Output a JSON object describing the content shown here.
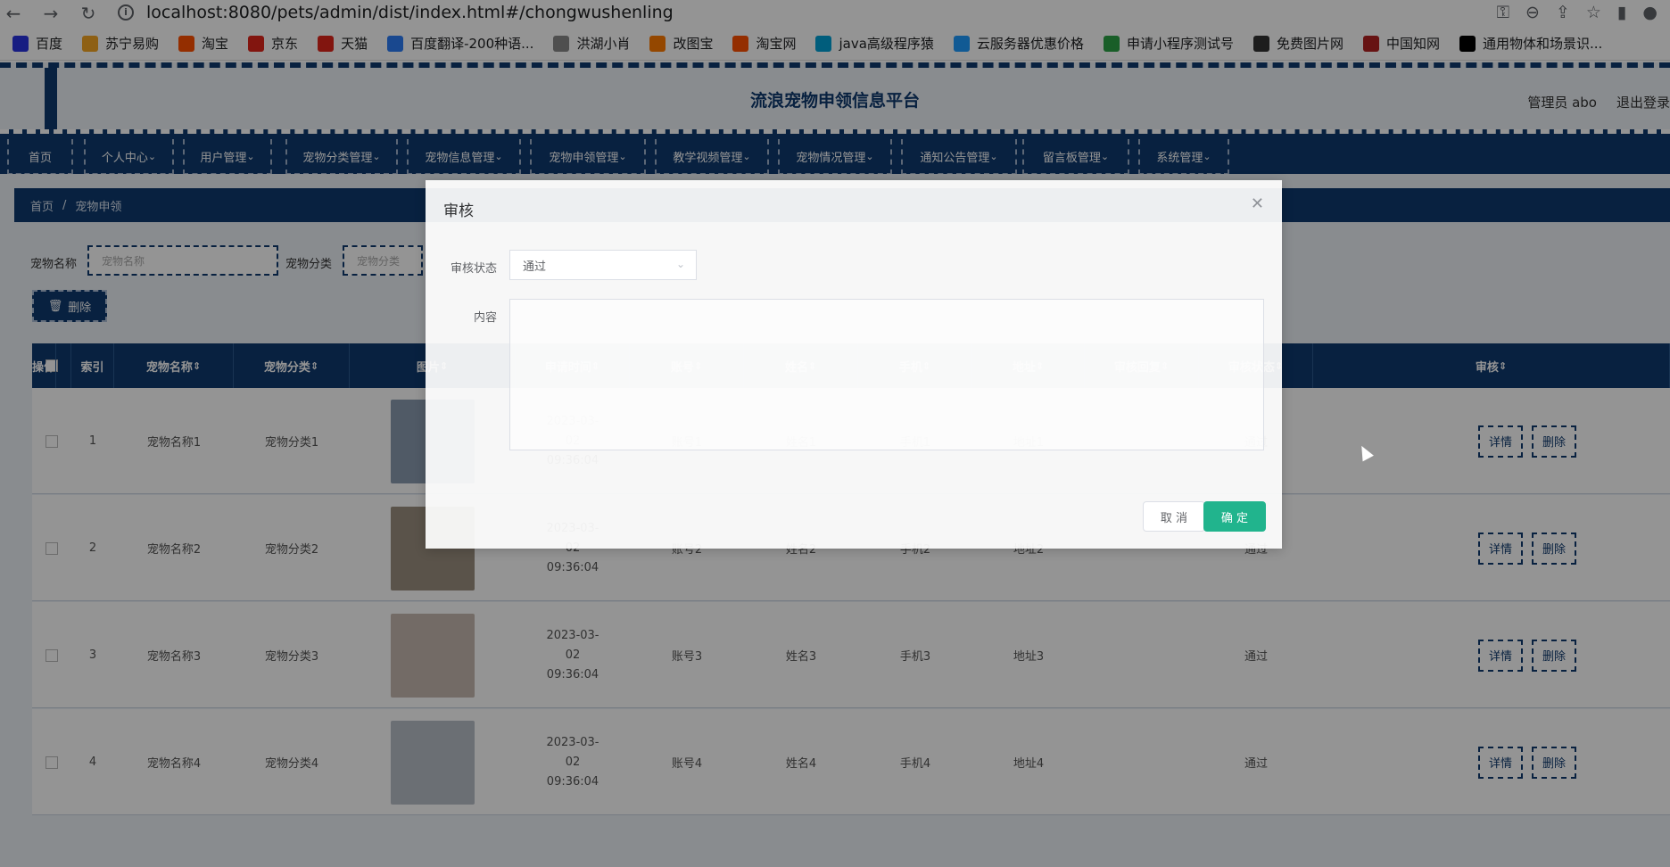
{
  "browser": {
    "url": "localhost:8080/pets/admin/dist/index.html#/chongwushenling"
  },
  "bookmarks": [
    {
      "label": "百度",
      "color": "#2932e1"
    },
    {
      "label": "苏宁易购",
      "color": "#f5a623"
    },
    {
      "label": "淘宝",
      "color": "#ff5000"
    },
    {
      "label": "京东",
      "color": "#e1251b"
    },
    {
      "label": "天猫",
      "color": "#e1251b"
    },
    {
      "label": "百度翻译-200种语...",
      "color": "#2b7cf6"
    },
    {
      "label": "洪湖小肖",
      "color": "#888888"
    },
    {
      "label": "改图宝",
      "color": "#ff7a00"
    },
    {
      "label": "淘宝网",
      "color": "#ff5000"
    },
    {
      "label": "java高级程序猿",
      "color": "#00a1d6"
    },
    {
      "label": "云服务器优惠价格",
      "color": "#1e9bff"
    },
    {
      "label": "申请小程序测试号",
      "color": "#2ba245"
    },
    {
      "label": "免费图片网",
      "color": "#333333"
    },
    {
      "label": "中国知网",
      "color": "#b22222"
    },
    {
      "label": "通用物体和场景识...",
      "color": "#000000"
    }
  ],
  "app": {
    "title": "流浪宠物申领信息平台",
    "admin": "管理员 abo",
    "logout": "退出登录"
  },
  "menu": [
    {
      "label": "首页"
    },
    {
      "label": "个人中心"
    },
    {
      "label": "用户管理"
    },
    {
      "label": "宠物分类管理"
    },
    {
      "label": "宠物信息管理"
    },
    {
      "label": "宠物申领管理"
    },
    {
      "label": "教学视频管理"
    },
    {
      "label": "宠物情况管理"
    },
    {
      "label": "通知公告管理"
    },
    {
      "label": "留言板管理"
    },
    {
      "label": "系统管理"
    }
  ],
  "breadcrumb": {
    "home": "首页",
    "sep": "/",
    "current": "宠物申领"
  },
  "search": {
    "name_label": "宠物名称",
    "name_placeholder": "宠物名称",
    "category_label": "宠物分类",
    "category_placeholder": "宠物分类"
  },
  "toolbar": {
    "delete": "删除"
  },
  "table": {
    "headers": [
      "索引",
      "宠物名称",
      "宠物分类",
      "图片",
      "申请时间",
      "账号",
      "姓名",
      "手机",
      "地址",
      "审核回复",
      "审核状态",
      "审核",
      "操作"
    ],
    "rows": [
      {
        "index": "1",
        "name": "宠物名称1",
        "category": "宠物分类1",
        "time": "2023-03-02 09:36:04",
        "account": "账号1",
        "realname": "姓名1",
        "phone": "手机1",
        "addr": "地址1",
        "reply": "",
        "status": "通过",
        "img": "#8a9bb0"
      },
      {
        "index": "2",
        "name": "宠物名称2",
        "category": "宠物分类2",
        "time": "2023-03-02 09:36:04",
        "account": "账号2",
        "realname": "姓名2",
        "phone": "手机2",
        "addr": "地址2",
        "reply": "",
        "status": "通过",
        "img": "#9c8f80"
      },
      {
        "index": "3",
        "name": "宠物名称3",
        "category": "宠物分类3",
        "time": "2023-03-02 09:36:04",
        "account": "账号3",
        "realname": "姓名3",
        "phone": "手机3",
        "addr": "地址3",
        "reply": "",
        "status": "通过",
        "img": "#c7b9b0"
      },
      {
        "index": "4",
        "name": "宠物名称4",
        "category": "宠物分类4",
        "time": "2023-03-02 09:36:04",
        "account": "账号4",
        "realname": "姓名4",
        "phone": "手机4",
        "addr": "地址4",
        "reply": "",
        "status": "通过",
        "img": "#b8bfc8"
      }
    ],
    "audit_link": "审核",
    "detail_btn": "详情",
    "delete_btn": "删除"
  },
  "dialog": {
    "title": "审核",
    "status_label": "审核状态",
    "status_value": "通过",
    "content_label": "内容",
    "cancel": "取 消",
    "ok": "确 定"
  }
}
